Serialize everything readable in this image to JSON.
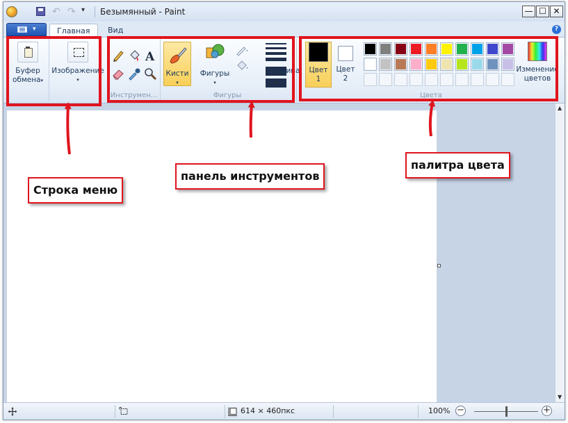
{
  "window": {
    "title": "Безымянный - Paint",
    "min_symbol": "—",
    "max_symbol": "☐",
    "close_symbol": "✕"
  },
  "quick_access": {
    "undo_symbol": "↶",
    "redo_symbol": "↷",
    "more_symbol": "▾"
  },
  "tabs": {
    "file_caret": "▾",
    "home": "Главная",
    "view": "Вид",
    "help_symbol": "?"
  },
  "ribbon": {
    "clipboard": {
      "label_line1": "Буфер",
      "label_line2": "обмена",
      "caret": "▾"
    },
    "image": {
      "label": "Изображение",
      "caret": "▾"
    },
    "tools": {
      "group_label": "Инструмен...",
      "text_tool": "A"
    },
    "brushes": {
      "label": "Кисти",
      "caret": "▾"
    },
    "shapes": {
      "label": "Фигуры",
      "caret": "▾",
      "group_label": "Фигуры"
    },
    "size": {
      "label": "Толщина",
      "caret": "▾"
    },
    "colors": {
      "color1_line1": "Цвет",
      "color1_line2": "1",
      "color2_line1": "Цвет",
      "color2_line2": "2",
      "color1_value": "#000000",
      "color2_value": "#ffffff",
      "edit_line1": "Изменение",
      "edit_line2": "цветов",
      "group_label": "Цвета",
      "palette_row1": [
        "#000000",
        "#7f7f7f",
        "#880015",
        "#ed1c24",
        "#ff7f27",
        "#fff200",
        "#22b14c",
        "#00a2e8",
        "#3f48cc",
        "#a349a4"
      ],
      "palette_row2": [
        "#ffffff",
        "#c3c3c3",
        "#b97a57",
        "#ffaec9",
        "#ffc90e",
        "#efe4b0",
        "#b5e61d",
        "#99d9ea",
        "#7092be",
        "#c8bfe7"
      ],
      "palette_row3": [
        "#ffffff",
        "#ffffff",
        "#ffffff",
        "#ffffff",
        "#ffffff",
        "#ffffff",
        "#ffffff",
        "#ffffff",
        "#ffffff",
        "#ffffff"
      ]
    }
  },
  "statusbar": {
    "canvas_size": "614 × 460пкс",
    "zoom": "100%",
    "zoom_minus": "−",
    "zoom_plus": "+"
  },
  "annotations": {
    "menu_row": "Строка меню",
    "toolbar": "панель инструментов",
    "palette": "палитра цвета"
  },
  "accent_colors": {
    "annotation_red": "#e0141e",
    "ribbon_bg": "#e6eef8"
  }
}
